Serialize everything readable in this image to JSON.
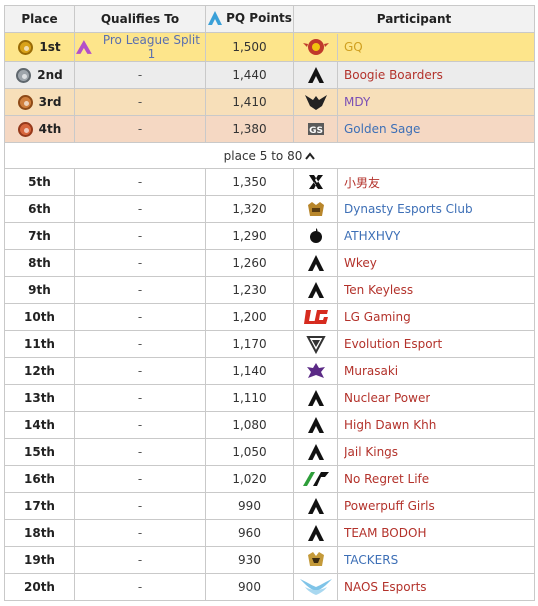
{
  "headers": {
    "place": "Place",
    "qualifies": "Qualifies To",
    "points": "PQ Points",
    "participant": "Participant"
  },
  "top": [
    {
      "place": "1st",
      "medal": "gold-medal-icon",
      "qualifies": "Pro League Split 1",
      "points": "1,500",
      "name": "GQ",
      "logo": "gq-logo",
      "name_color": "#d0a020"
    },
    {
      "place": "2nd",
      "medal": "silver-medal-icon",
      "qualifies": "-",
      "points": "1,440",
      "name": "Boogie Boarders",
      "logo": "apex-logo",
      "name_color": "#b3322b"
    },
    {
      "place": "3rd",
      "medal": "bronze-medal-icon",
      "qualifies": "-",
      "points": "1,410",
      "name": "MDY",
      "logo": "mdy-logo",
      "name_color": "#7a4fb5"
    },
    {
      "place": "4th",
      "medal": "copper-medal-icon",
      "qualifies": "-",
      "points": "1,380",
      "name": "Golden Sage",
      "logo": "gs-logo",
      "name_color": "#3d6fb6"
    }
  ],
  "toggle_label": "place 5 to 80",
  "rows": [
    {
      "place": "5th",
      "qualifies": "-",
      "points": "1,350",
      "name": "小男友",
      "logo": "x-logo",
      "name_color": "#b3322b"
    },
    {
      "place": "6th",
      "qualifies": "-",
      "points": "1,320",
      "name": "Dynasty Esports Club",
      "logo": "dynasty-logo",
      "name_color": "#3d6fb6"
    },
    {
      "place": "7th",
      "qualifies": "-",
      "points": "1,290",
      "name": "ATHXHVY",
      "logo": "athxhvy-logo",
      "name_color": "#3d6fb6"
    },
    {
      "place": "8th",
      "qualifies": "-",
      "points": "1,260",
      "name": "Wkey",
      "logo": "apex-logo",
      "name_color": "#b3322b"
    },
    {
      "place": "9th",
      "qualifies": "-",
      "points": "1,230",
      "name": "Ten Keyless",
      "logo": "apex-logo",
      "name_color": "#b3322b"
    },
    {
      "place": "10th",
      "qualifies": "-",
      "points": "1,200",
      "name": "LG Gaming",
      "logo": "lg-logo",
      "name_color": "#b3322b"
    },
    {
      "place": "11th",
      "qualifies": "-",
      "points": "1,170",
      "name": "Evolution Esport",
      "logo": "evolution-logo",
      "name_color": "#b3322b"
    },
    {
      "place": "12th",
      "qualifies": "-",
      "points": "1,140",
      "name": "Murasaki",
      "logo": "murasaki-logo",
      "name_color": "#b3322b"
    },
    {
      "place": "13th",
      "qualifies": "-",
      "points": "1,110",
      "name": "Nuclear Power",
      "logo": "apex-logo",
      "name_color": "#b3322b"
    },
    {
      "place": "14th",
      "qualifies": "-",
      "points": "1,080",
      "name": "High Dawn Khh",
      "logo": "apex-logo",
      "name_color": "#b3322b"
    },
    {
      "place": "15th",
      "qualifies": "-",
      "points": "1,050",
      "name": "Jail Kings",
      "logo": "apex-logo",
      "name_color": "#b3322b"
    },
    {
      "place": "16th",
      "qualifies": "-",
      "points": "1,020",
      "name": "No Regret Life",
      "logo": "nrl-logo",
      "name_color": "#b3322b"
    },
    {
      "place": "17th",
      "qualifies": "-",
      "points": "990",
      "name": "Powerpuff Girls",
      "logo": "apex-logo",
      "name_color": "#b3322b"
    },
    {
      "place": "18th",
      "qualifies": "-",
      "points": "960",
      "name": "TEAM BODOH",
      "logo": "apex-logo",
      "name_color": "#b3322b"
    },
    {
      "place": "19th",
      "qualifies": "-",
      "points": "930",
      "name": "TACKERS",
      "logo": "tackers-logo",
      "name_color": "#3d6fb6"
    },
    {
      "place": "20th",
      "qualifies": "-",
      "points": "900",
      "name": "NAOS Esports",
      "logo": "naos-logo",
      "name_color": "#b3322b"
    }
  ]
}
